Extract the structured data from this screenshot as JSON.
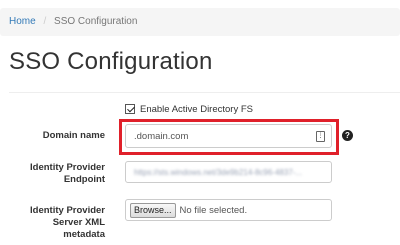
{
  "breadcrumb": {
    "home": "Home",
    "separator": "/",
    "current": "SSO Configuration"
  },
  "page_title": "SSO Configuration",
  "adfs_checkbox": {
    "label": "Enable Active Directory FS",
    "checked": true
  },
  "domain": {
    "label": "Domain name",
    "value": ".domain.com",
    "help": "?"
  },
  "idp_endpoint": {
    "label_line1": "Identity Provider",
    "label_line2": "Endpoint",
    "value": "https://sts.windows.net/3de9b214-8c96-4837-..."
  },
  "idp_metadata": {
    "label_line1": "Identity Provider",
    "label_line2": "Server XML",
    "label_line3": "metadata",
    "browse_label": "Browse...",
    "file_status": "No file selected."
  },
  "colors": {
    "highlight": "#e0202a",
    "link": "#337ab7"
  }
}
